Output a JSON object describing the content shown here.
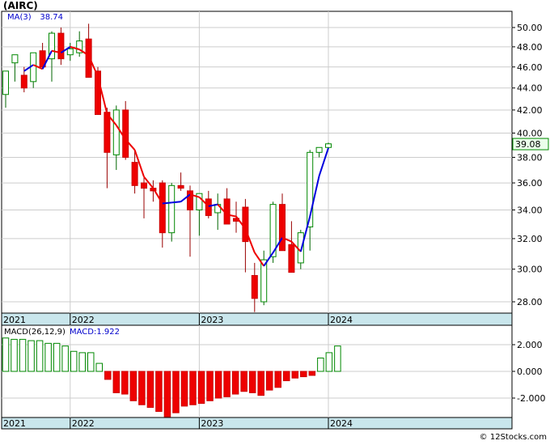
{
  "chart_data": [
    {
      "type": "candlestick",
      "title": "(AIRC)",
      "legend": [
        {
          "label": "MA(3)",
          "value": "38.74",
          "color": "#0000cc"
        }
      ],
      "y_ticks": [
        "50.00",
        "48.00",
        "46.00",
        "44.00",
        "42.00",
        "40.00",
        "38.00",
        "36.00",
        "34.00",
        "32.00",
        "30.00",
        "28.00"
      ],
      "x_ticks": [
        {
          "label": "2021",
          "index": 0
        },
        {
          "label": "2022",
          "index": 7
        },
        {
          "label": "2023",
          "index": 21
        },
        {
          "label": "2024",
          "index": 35
        }
      ],
      "last_price_label": "39.08",
      "log_scale": true,
      "grid": true,
      "candles": [
        {
          "o": 43.4,
          "h": 45.2,
          "l": 42.2,
          "c": 45.6,
          "hh": 46.8
        },
        {
          "o": 46.4,
          "h": 47.2,
          "l": 44.6,
          "c": 47.2
        },
        {
          "o": 45.2,
          "h": 46.0,
          "l": 43.6,
          "c": 44.0
        },
        {
          "o": 44.6,
          "h": 47.4,
          "l": 44.0,
          "c": 47.4
        },
        {
          "o": 47.6,
          "h": 48.4,
          "l": 45.8,
          "c": 46.0
        },
        {
          "o": 46.8,
          "h": 49.6,
          "l": 44.6,
          "c": 49.4
        },
        {
          "o": 49.4,
          "h": 50.0,
          "l": 46.2,
          "c": 46.8
        },
        {
          "o": 47.2,
          "h": 48.4,
          "l": 46.6,
          "c": 47.8
        },
        {
          "o": 47.4,
          "h": 49.6,
          "l": 47.0,
          "c": 48.6
        },
        {
          "o": 48.8,
          "h": 50.4,
          "l": 45.6,
          "c": 45.0
        },
        {
          "o": 45.6,
          "h": 46.0,
          "l": 41.8,
          "c": 41.6
        },
        {
          "o": 41.8,
          "h": 42.2,
          "l": 35.6,
          "c": 38.4
        },
        {
          "o": 38.2,
          "h": 42.4,
          "l": 37.0,
          "c": 42.0
        },
        {
          "o": 42.0,
          "h": 42.8,
          "l": 37.8,
          "c": 38.0
        },
        {
          "o": 37.6,
          "h": 38.6,
          "l": 35.2,
          "c": 35.8
        },
        {
          "o": 36.0,
          "h": 36.4,
          "l": 33.4,
          "c": 35.6
        },
        {
          "o": 35.6,
          "h": 36.2,
          "l": 34.6,
          "c": 35.4
        },
        {
          "o": 36.0,
          "h": 36.2,
          "l": 31.4,
          "c": 32.4
        },
        {
          "o": 32.4,
          "h": 36.0,
          "l": 31.8,
          "c": 35.8
        },
        {
          "o": 35.8,
          "h": 36.8,
          "l": 35.4,
          "c": 35.6
        },
        {
          "o": 35.4,
          "h": 35.8,
          "l": 30.8,
          "c": 34.0
        },
        {
          "o": 34.0,
          "h": 34.8,
          "l": 32.2,
          "c": 35.2
        },
        {
          "o": 34.8,
          "h": 35.4,
          "l": 33.4,
          "c": 33.6
        },
        {
          "o": 33.8,
          "h": 35.2,
          "l": 32.6,
          "c": 34.4
        },
        {
          "o": 34.8,
          "h": 35.6,
          "l": 33.2,
          "c": 33.0
        },
        {
          "o": 33.4,
          "h": 34.6,
          "l": 32.4,
          "c": 33.2
        },
        {
          "o": 34.2,
          "h": 34.8,
          "l": 29.8,
          "c": 31.8
        },
        {
          "o": 29.6,
          "h": 30.4,
          "l": 27.4,
          "c": 28.2
        },
        {
          "o": 28.0,
          "h": 31.2,
          "l": 27.8,
          "c": 30.6
        },
        {
          "o": 30.8,
          "h": 34.6,
          "l": 30.4,
          "c": 34.4
        },
        {
          "o": 34.4,
          "h": 35.2,
          "l": 32.4,
          "c": 31.2
        },
        {
          "o": 31.6,
          "h": 33.2,
          "l": 30.0,
          "c": 29.8
        },
        {
          "o": 30.4,
          "h": 32.6,
          "l": 30.0,
          "c": 32.4
        },
        {
          "o": 32.8,
          "h": 38.6,
          "l": 31.2,
          "c": 38.4
        },
        {
          "o": 38.4,
          "h": 38.8,
          "l": 38.0,
          "c": 38.8
        },
        {
          "o": 38.8,
          "h": 39.2,
          "l": 38.6,
          "c": 39.1
        }
      ]
    },
    {
      "type": "bar",
      "title": "MACD(26,12,9)",
      "legend": [
        {
          "label": "MACD",
          "value": "1.922",
          "color": "#0000cc"
        }
      ],
      "y_ticks": [
        "2.000",
        "0.000",
        "-2.000"
      ],
      "ylim": [
        -3.4,
        3.0
      ],
      "x_ticks": [
        {
          "label": "2021",
          "index": 0
        },
        {
          "label": "2022",
          "index": 7
        },
        {
          "label": "2023",
          "index": 21
        },
        {
          "label": "2024",
          "index": 35
        }
      ],
      "values": [
        2.5,
        2.4,
        2.4,
        2.3,
        2.3,
        2.1,
        2.1,
        1.9,
        1.5,
        1.4,
        1.4,
        0.6,
        -0.6,
        -1.6,
        -1.7,
        -2.2,
        -2.5,
        -2.7,
        -3.0,
        -3.4,
        -3.1,
        -2.6,
        -2.5,
        -2.4,
        -2.2,
        -2.0,
        -1.9,
        -1.7,
        -1.5,
        -1.6,
        -1.8,
        -1.4,
        -1.2,
        -0.7,
        -0.5,
        -0.4,
        -0.3,
        1.0,
        1.4,
        1.9
      ]
    }
  ],
  "footer": {
    "copyright": "© 12Stocks.com"
  }
}
